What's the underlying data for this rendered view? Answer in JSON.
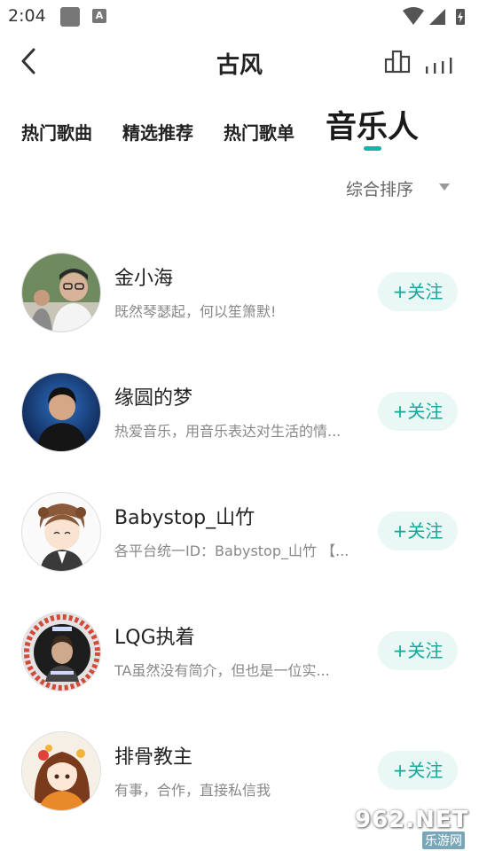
{
  "status": {
    "time": "2:04",
    "notification_icon": "a-icon"
  },
  "header": {
    "title": "古风"
  },
  "tabs": [
    {
      "label": "热门歌曲",
      "active": false
    },
    {
      "label": "精选推荐",
      "active": false
    },
    {
      "label": "热门歌单",
      "active": false
    },
    {
      "label": "音乐人",
      "active": true
    }
  ],
  "sort": {
    "label": "综合排序"
  },
  "artists": [
    {
      "name": "金小海",
      "desc": "既然琴瑟起，何以笙箫默!",
      "follow": "+关注"
    },
    {
      "name": "缘圆的梦",
      "desc": "热爱音乐，用音乐表达对生活的情...",
      "follow": "+关注"
    },
    {
      "name": "Babystop_山竹",
      "desc": "各平台统一ID：Babystop_山竹 【...",
      "follow": "+关注"
    },
    {
      "name": "LQG执着",
      "desc": "TA虽然没有简介，但也是一位实...",
      "follow": "+关注"
    },
    {
      "name": "排骨教主",
      "desc": "有事，合作，直接私信我",
      "follow": "+关注"
    }
  ],
  "colors": {
    "accent": "#16b3a8",
    "follow_bg": "#e9f7f5"
  },
  "watermark": {
    "main": "962.NET",
    "sub": "乐游网"
  }
}
